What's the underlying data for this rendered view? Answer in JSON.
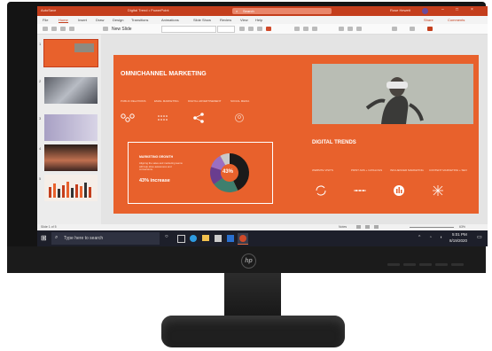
{
  "titlebar": {
    "autosave": "AutoSave",
    "doc_title": "Digital Trend • PowerPoint",
    "search_placeholder": "Search",
    "user": "Rose Hewett"
  },
  "menu": [
    "File",
    "Home",
    "Insert",
    "Draw",
    "Design",
    "Transitions",
    "Animations",
    "Slide Show",
    "Review",
    "View",
    "Help"
  ],
  "share_label": "Share",
  "comments_label": "Comments",
  "ribbon": {
    "new_slide": "New Slide"
  },
  "thumbnails": [
    "1",
    "2",
    "3",
    "4",
    "5"
  ],
  "slide": {
    "title": "OMNICHANNEL MARKETING",
    "channels": [
      {
        "label": "PUBLIC RELATIONS",
        "icon": "network-icon"
      },
      {
        "label": "EMAIL MARKETING",
        "icon": "dots-grid-icon"
      },
      {
        "label": "DIGITAL ADVERTISEMENT",
        "icon": "share-icon"
      },
      {
        "label": "SOCIAL MEDIA",
        "icon": "people-icon"
      }
    ],
    "growth": {
      "title": "MARKETING GROWTH",
      "body": "Aligning the sales and marketing teams will help drive awareness and conversions.",
      "increase": "43% increase",
      "donut_center": "43%"
    },
    "donut_values": [
      43,
      22,
      15,
      12,
      8
    ],
    "donut_colors": [
      "#1a1a1a",
      "#3e7f6e",
      "#6a3d8f",
      "#9b6fc2",
      "#c9c9c9"
    ],
    "trends_title": "DIGITAL TRENDS",
    "trends": [
      {
        "label": "WEBSITE VISITS",
        "icon": "refresh-icon"
      },
      {
        "label": "PRINT ADS + CATALOGS",
        "icon": "timeline-icon"
      },
      {
        "label": "INFLUENCER MARKETING",
        "icon": "chart-icon"
      },
      {
        "label": "CONTENT MARKETING + SEO",
        "icon": "burst-icon"
      }
    ]
  },
  "status": {
    "slide_info": "Slide 1 of 5",
    "notes": "Notes",
    "zoom": "63%"
  },
  "taskbar": {
    "search_placeholder": "Type here to search",
    "time": "5:01 PM",
    "date": "8/19/2020"
  },
  "colors": {
    "accent": "#c43e1c",
    "slide_bg": "#e8612c",
    "taskbar": "#1d1f2a"
  }
}
